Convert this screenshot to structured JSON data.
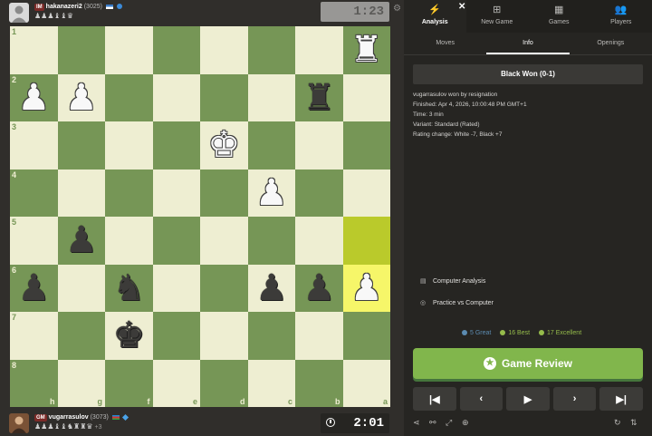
{
  "top_player": {
    "title": "IM",
    "name": "hakanazeri2",
    "rating": "(3025)",
    "captured": "♟♟♟♝♝♛",
    "clock": "1:23"
  },
  "bottom_player": {
    "title": "GM",
    "name": "vugarrasulov",
    "rating": "(3073)",
    "captured": "♟♟♟♝♝♞♜♜♛",
    "extra": "+3",
    "clock": "2:01"
  },
  "board": {
    "ranks": [
      "1",
      "2",
      "3",
      "4",
      "5",
      "6",
      "7",
      "8"
    ],
    "files": [
      "h",
      "g",
      "f",
      "e",
      "d",
      "c",
      "b",
      "a"
    ],
    "pieces": {
      "a1": "♜",
      "h2": "♟",
      "g2": "♟",
      "b2": "♜",
      "d3": "♚",
      "c4": "♟",
      "g5": "♟",
      "h6": "♟",
      "f6": "♞",
      "c6": "♟",
      "b6": "♟",
      "a6": "♟",
      "f7": "♚"
    },
    "colors": {
      "a1": "w",
      "h2": "w",
      "g2": "w",
      "b2": "b",
      "d3": "w",
      "c4": "w",
      "g5": "b",
      "h6": "b",
      "f6": "b",
      "c6": "b",
      "b6": "b",
      "a6": "w",
      "f7": "b"
    },
    "highlight": [
      "a5",
      "a6"
    ]
  },
  "nav": {
    "close": "✕",
    "items": [
      {
        "label": "Analysis",
        "icon": "⚡"
      },
      {
        "label": "New Game",
        "icon": "⊞"
      },
      {
        "label": "Games",
        "icon": "▦"
      },
      {
        "label": "Players",
        "icon": "👥"
      }
    ]
  },
  "subtabs": [
    "Moves",
    "Info",
    "Openings"
  ],
  "result": "Black Won (0-1)",
  "details": [
    "vugarrasulov won by resignation",
    "Finished: Apr 4, 2026, 10:00:48 PM GMT+1",
    "Time: 3 min",
    "Variant: Standard (Rated)",
    "Rating change: White -7, Black +7"
  ],
  "actions": {
    "computer_analysis": "Computer Analysis",
    "practice": "Practice vs Computer"
  },
  "stats": {
    "great": "5 Great",
    "best": "16 Best",
    "excellent": "17 Excellent"
  },
  "review_button": "Game Review",
  "nav_buttons": [
    "|◀",
    "‹",
    "▶",
    "›",
    "▶|"
  ],
  "colors": {
    "board_light": "#eeeed2",
    "board_dark": "#769656",
    "review_green": "#81b64c",
    "panel_bg": "#262522"
  }
}
